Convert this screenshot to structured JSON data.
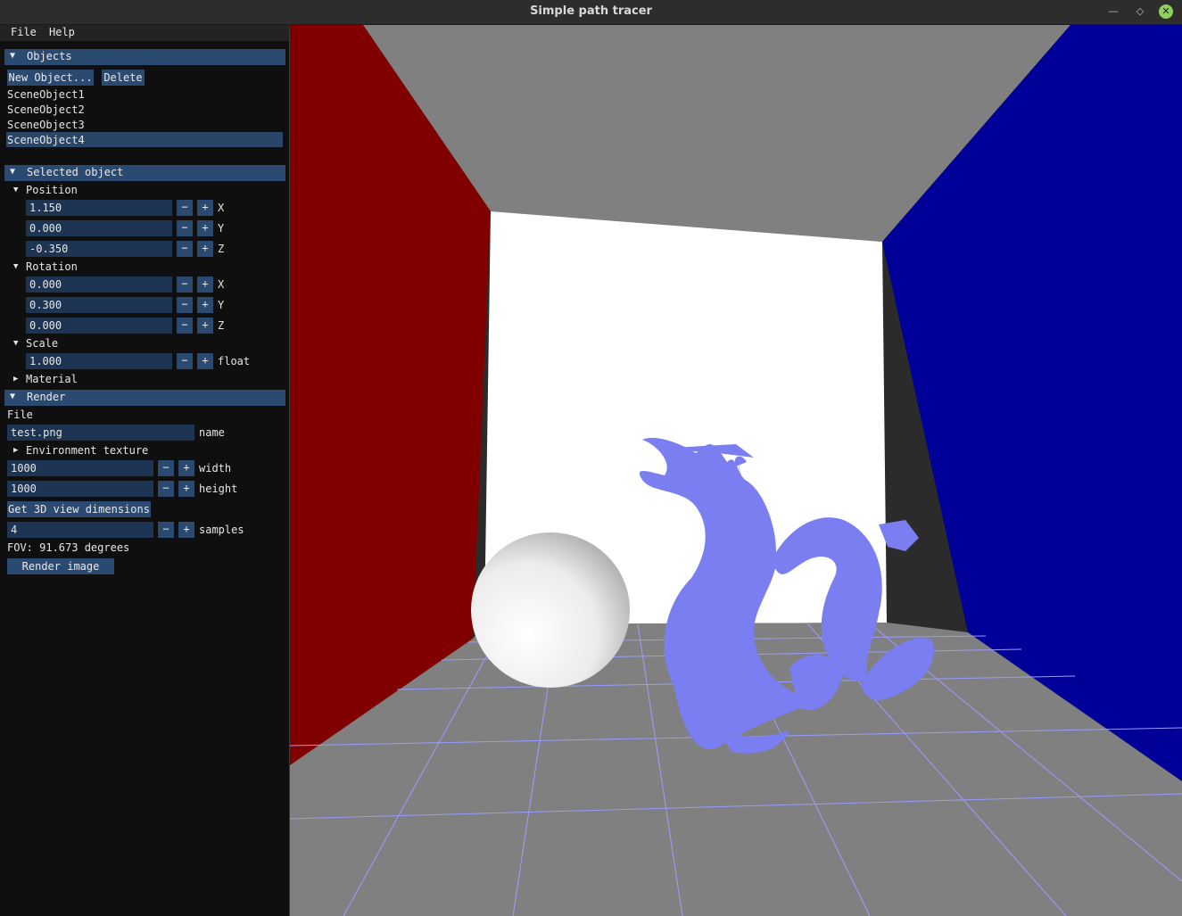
{
  "window": {
    "title": "Simple path tracer"
  },
  "menu": {
    "file": "File",
    "help": "Help"
  },
  "objects": {
    "header": "Objects",
    "new_button": "New Object...",
    "delete_button": "Delete",
    "items": [
      "SceneObject1",
      "SceneObject2",
      "SceneObject3",
      "SceneObject4"
    ],
    "selected": "SceneObject4"
  },
  "selected_object": {
    "header": "Selected object",
    "position": {
      "label": "Position",
      "x": "1.150",
      "y": "0.000",
      "z": "-0.350"
    },
    "rotation": {
      "label": "Rotation",
      "x": "0.000",
      "y": "0.300",
      "z": "0.000"
    },
    "scale": {
      "label": "Scale",
      "value": "1.000",
      "type": "float"
    },
    "material": {
      "label": "Material"
    },
    "axis": {
      "x": "X",
      "y": "Y",
      "z": "Z"
    }
  },
  "render": {
    "header": "Render",
    "file_label": "File",
    "filename": "test.png",
    "name_label": "name",
    "env_texture": "Environment texture",
    "width": "1000",
    "width_label": "width",
    "height": "1000",
    "height_label": "height",
    "get_dims_button": "Get 3D view dimensions",
    "samples": "4",
    "samples_label": "samples",
    "fov": "FOV: 91.673 degrees",
    "render_button": "Render image"
  },
  "glyphs": {
    "minus": "−",
    "plus": "+",
    "down": "▼",
    "right": "▶"
  },
  "colors": {
    "left_wall": "#800000",
    "right_wall": "#000099",
    "back_wall": "#ffffff",
    "ceiling": "#808080",
    "floor": "#808080",
    "grid_lines": "#9b9bff",
    "dragon": "#7a7ef0",
    "sphere": "#ffffff",
    "panel_button": "#2a4a72"
  }
}
